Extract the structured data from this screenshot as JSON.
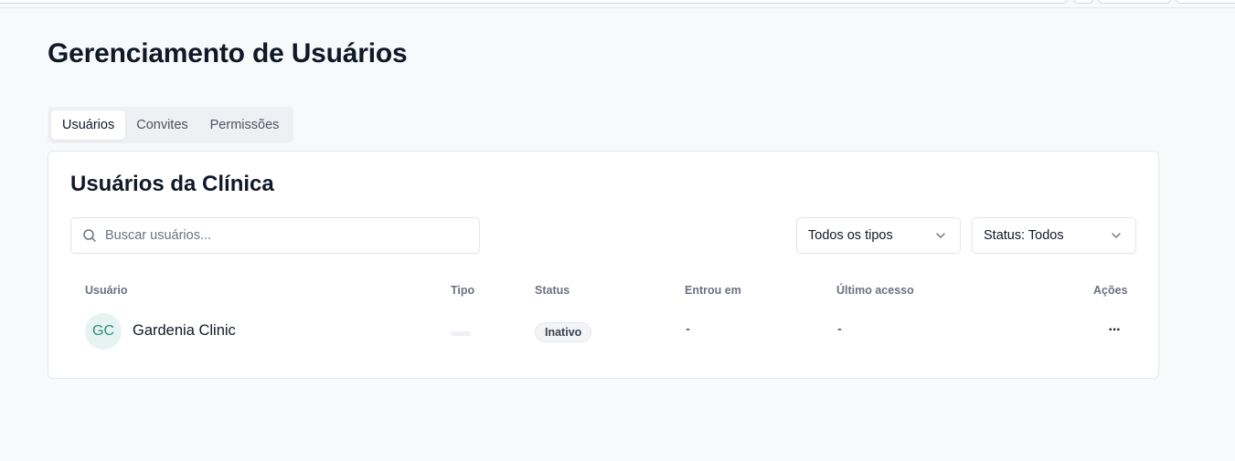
{
  "page": {
    "title": "Gerenciamento de Usuários"
  },
  "tabs": [
    {
      "label": "Usuários",
      "active": true
    },
    {
      "label": "Convites",
      "active": false
    },
    {
      "label": "Permissões",
      "active": false
    }
  ],
  "card": {
    "title": "Usuários da Clínica",
    "search": {
      "placeholder": "Buscar usuários...",
      "value": "",
      "icon": "search-icon"
    },
    "filters": {
      "type": {
        "selected": "Todos os tipos",
        "icon": "chevron-down-icon"
      },
      "status": {
        "selected": "Status: Todos",
        "icon": "chevron-down-icon"
      }
    },
    "table": {
      "columns": [
        "Usuário",
        "Tipo",
        "Status",
        "Entrou em",
        "Último acesso",
        "Ações"
      ],
      "rows": [
        {
          "avatar_initials": "GC",
          "name": "Gardenia Clinic",
          "type": "",
          "status": "Inativo",
          "joined": "-",
          "last_access": "-",
          "actions": "···"
        }
      ]
    }
  },
  "colors": {
    "accent": "#2a8f80",
    "avatar_bg": "#e6f3f1",
    "badge_bg": "#f3f4f6"
  }
}
